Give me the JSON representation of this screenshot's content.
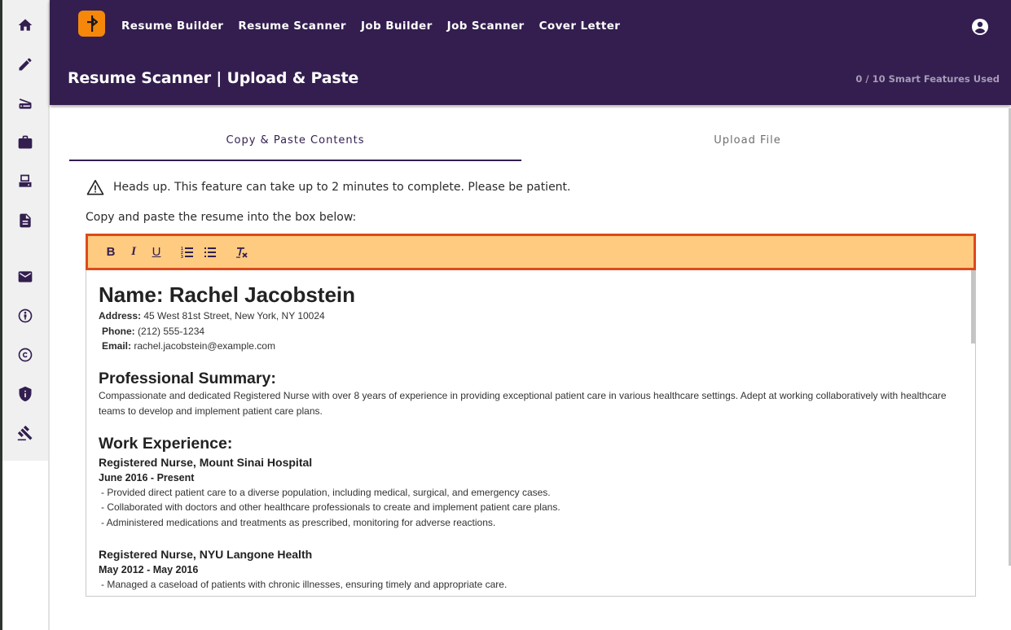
{
  "header": {
    "logo_icon": "signpost-logo",
    "nav": [
      {
        "label": "Resume Builder"
      },
      {
        "label": "Resume Scanner"
      },
      {
        "label": "Job Builder"
      },
      {
        "label": "Job Scanner"
      },
      {
        "label": "Cover Letter"
      }
    ],
    "account_icon": "account-circle-icon",
    "page_title": "Resume Scanner | Upload & Paste",
    "usage_text": "0 / 10 Smart Features Used"
  },
  "sidebar": {
    "items": [
      {
        "name": "home",
        "icon": "home-icon"
      },
      {
        "name": "edit",
        "icon": "pencil-icon"
      },
      {
        "name": "scanner",
        "icon": "scanner-icon"
      },
      {
        "name": "jobs",
        "icon": "briefcase-icon"
      },
      {
        "name": "fax",
        "icon": "fax-icon"
      },
      {
        "name": "document",
        "icon": "document-icon"
      },
      {
        "name": "contact",
        "icon": "mail-icon"
      },
      {
        "name": "accessibility",
        "icon": "accessibility-icon"
      },
      {
        "name": "copyright",
        "icon": "copyright-icon"
      },
      {
        "name": "privacy",
        "icon": "shield-info-icon"
      },
      {
        "name": "legal",
        "icon": "gavel-icon"
      }
    ]
  },
  "tabs": [
    {
      "label": "Copy & Paste Contents",
      "active": true
    },
    {
      "label": "Upload File",
      "active": false
    }
  ],
  "notice": {
    "icon": "warning-icon",
    "text": "Heads up. This feature can take up to 2 minutes to complete. Please be patient."
  },
  "instructions": "Copy and paste the resume into the box below:",
  "toolbar": {
    "bold": "B",
    "italic": "I",
    "underline": "U",
    "ordered_list": "ordered-list-icon",
    "bullet_list": "bullet-list-icon",
    "clear_format": "clear-formatting-icon",
    "colors": {
      "background": "#fecb81",
      "border": "#dd4a1c"
    }
  },
  "resume": {
    "name_heading": "Name: Rachel Jacobstein",
    "address_label": "Address:",
    "address": " 45 West 81st Street, New York, NY 10024",
    "phone_label": "Phone:",
    "phone": " (212) 555-1234",
    "email_label": "Email:",
    "email": " rachel.jacobstein@example.com",
    "summary_heading": "Professional Summary:",
    "summary": "Compassionate and dedicated Registered Nurse with over 8 years of experience in providing exceptional patient care in various healthcare settings. Adept at working collaboratively with healthcare teams to develop and implement patient care plans.",
    "experience_heading": "Work Experience:",
    "jobs": [
      {
        "title": "Registered Nurse, Mount Sinai Hospital",
        "dates": "June 2016 - Present",
        "bullets": [
          "- Provided direct patient care to a diverse population, including medical, surgical, and emergency cases.",
          "- Collaborated with doctors and other healthcare professionals to create and implement patient care plans.",
          "- Administered medications and treatments as prescribed, monitoring for adverse reactions."
        ]
      },
      {
        "title": "Registered Nurse, NYU Langone Health",
        "dates": "May 2012 - May 2016",
        "bullets": [
          "- Managed a caseload of patients with chronic illnesses, ensuring timely and appropriate care."
        ]
      }
    ]
  },
  "theme": {
    "primary": "#331e4f",
    "accent": "#f5870b",
    "sidebar_bg": "#f0f0f0"
  }
}
